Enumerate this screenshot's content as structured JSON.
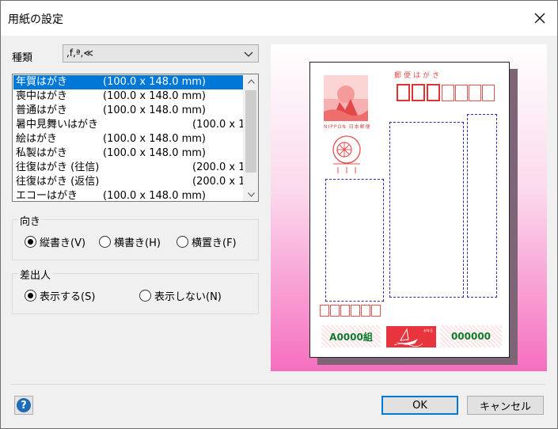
{
  "window": {
    "title": "用紙の設定"
  },
  "kind": {
    "label": "種類",
    "value": ",f,ª,≪"
  },
  "list": {
    "items": [
      {
        "name": "年賀はがき",
        "size": "(100.0 x 148.0 mm)",
        "selected": true
      },
      {
        "name": "喪中はがき",
        "size": "(100.0 x 148.0 mm)"
      },
      {
        "name": "普通はがき",
        "size": "(100.0 x 148.0 mm)"
      },
      {
        "name": "暑中見舞いはがき",
        "size": "(100.0 x 1"
      },
      {
        "name": "絵はがき",
        "size": "(100.0 x 148.0 mm)"
      },
      {
        "name": "私製はがき",
        "size": "(100.0 x 148.0 mm)"
      },
      {
        "name": "往復はがき (往信)",
        "size": "(200.0 x 1"
      },
      {
        "name": "往復はがき (返信)",
        "size": "(200.0 x 1"
      },
      {
        "name": "エコーはがき",
        "size": "(100.0 x 148.0 mm)"
      }
    ]
  },
  "orientation": {
    "title": "向き",
    "options": [
      {
        "label": "縦書き(V)",
        "checked": true
      },
      {
        "label": "横書き(H)",
        "checked": false
      },
      {
        "label": "横置き(F)",
        "checked": false
      }
    ]
  },
  "sender": {
    "title": "差出人",
    "options": [
      {
        "label": "表示する(S)",
        "checked": true
      },
      {
        "label": "表示しない(N)",
        "checked": false
      }
    ]
  },
  "preview": {
    "header": "郵便はがき",
    "stamp_text": "NIPPON 日本郵便",
    "lottery_left": "A0000組",
    "lottery_mid": "お年玉",
    "lottery_right": "000000"
  },
  "buttons": {
    "help": "?",
    "ok": "OK",
    "cancel": "キャンセル"
  },
  "colors": {
    "accent": "#0078d7",
    "stamp_red": "#e35050",
    "lottery_green": "#0e7a2e"
  }
}
